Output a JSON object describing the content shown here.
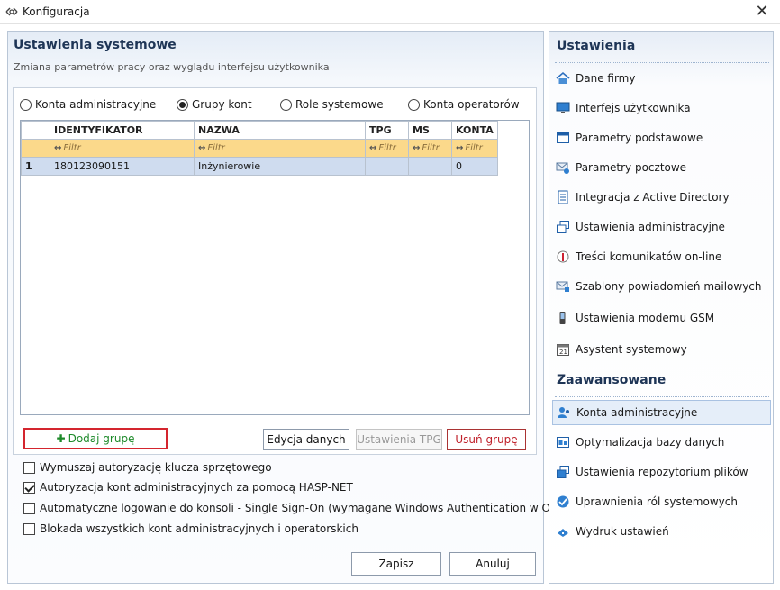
{
  "window": {
    "title": "Konfiguracja",
    "close_glyph": "✕"
  },
  "left": {
    "title": "Ustawienia systemowe",
    "subtitle": "Zmiana parametrów pracy oraz wyglądu interfejsu użytkownika",
    "radios": [
      {
        "label": "Konta administracyjne",
        "checked": false
      },
      {
        "label": "Grupy kont",
        "checked": true
      },
      {
        "label": "Role systemowe",
        "checked": false
      },
      {
        "label": "Konta operatorów",
        "checked": false
      }
    ],
    "grid": {
      "columns": [
        "IDENTYFIKATOR",
        "NAZWA",
        "TPG",
        "MS",
        "KONTA"
      ],
      "filter_placeholder": "Filtr",
      "rows": [
        {
          "num": "1",
          "cells": [
            "180123090151",
            "Inżynierowie",
            "",
            "",
            "0"
          ]
        }
      ]
    },
    "buttons": {
      "add": "Dodaj grupę",
      "edit": "Edycja danych",
      "tpg": "Ustawienia TPG",
      "remove": "Usuń grupę"
    },
    "checkboxes": [
      {
        "label": "Wymuszaj autoryzację klucza sprzętowego",
        "checked": false
      },
      {
        "label": "Autoryzacja kont administracyjnych za pomocą HASP-NET",
        "checked": true
      },
      {
        "label": "Automatyczne logowanie do konsoli - Single Sign-On (wymagane Windows Authentication w ODBC)",
        "checked": false
      },
      {
        "label": "Blokada wszystkich kont administracyjnych i operatorskich",
        "checked": false
      }
    ],
    "footer": {
      "save": "Zapisz",
      "cancel": "Anuluj"
    }
  },
  "right": {
    "section1": "Ustawienia",
    "items1": [
      {
        "label": "Dane firmy",
        "icon": "house-icon"
      },
      {
        "label": "Interfejs użytkownika",
        "icon": "monitor-icon"
      },
      {
        "label": "Parametry podstawowe",
        "icon": "window-icon"
      },
      {
        "label": "Parametry pocztowe",
        "icon": "mail-settings-icon"
      },
      {
        "label": "Integracja z Active Directory",
        "icon": "directory-icon"
      },
      {
        "label": "Ustawienia administracyjne",
        "icon": "windows-stack-icon"
      },
      {
        "label": "Treści komunikatów on-line",
        "icon": "message-icon"
      },
      {
        "label": "Szablony powiadomień mailowych",
        "icon": "mail-template-icon"
      },
      {
        "label": "Ustawienia modemu GSM",
        "icon": "phone-icon"
      },
      {
        "label": "Asystent systemowy",
        "icon": "calendar-icon"
      }
    ],
    "section2": "Zaawansowane",
    "items2": [
      {
        "label": "Konta administracyjne",
        "icon": "user-accounts-icon",
        "selected": true
      },
      {
        "label": "Optymalizacja bazy danych",
        "icon": "database-icon"
      },
      {
        "label": "Ustawienia repozytorium plików",
        "icon": "repository-icon"
      },
      {
        "label": "Uprawnienia ról systemowych",
        "icon": "permissions-icon"
      },
      {
        "label": "Wydruk ustawień",
        "icon": "print-icon"
      }
    ]
  },
  "colors": {
    "accent": "#1e3556",
    "filter_row": "#fbd98b",
    "selected_row": "#cfdcef",
    "add_border": "#d4252e"
  }
}
